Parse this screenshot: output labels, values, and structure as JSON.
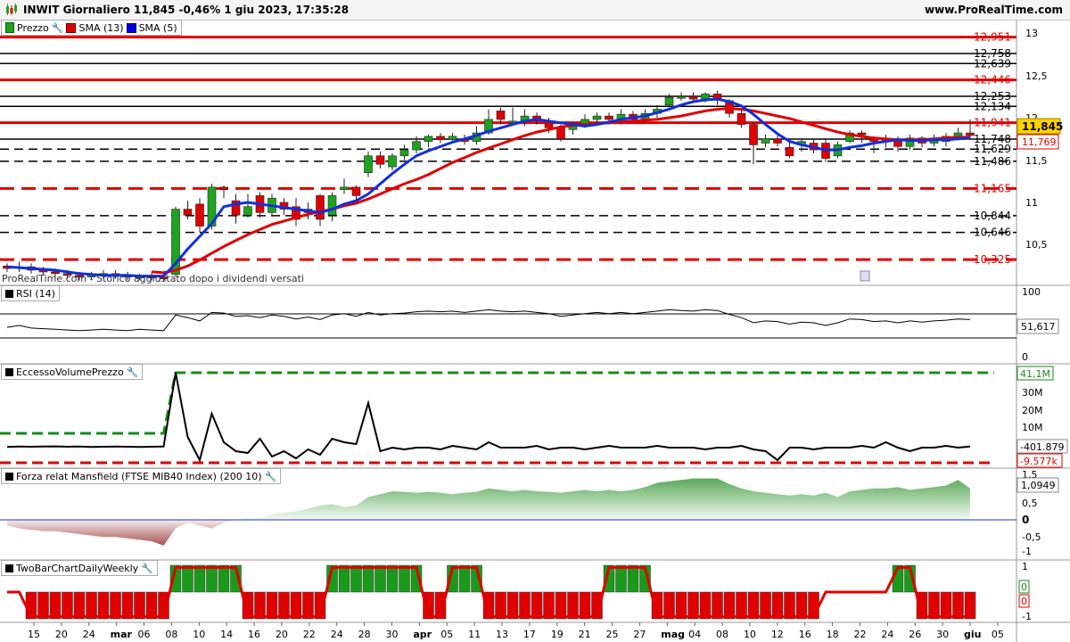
{
  "header": {
    "title": "INWIT Giornaliero 11,845 -0,46% 1 giu 2023, 17:35:28",
    "site": "www.ProRealTime.com"
  },
  "panels": {
    "price": {
      "legend": [
        {
          "label": "Prezzo",
          "color": "#1ea31e",
          "icon": "candlestick-icon"
        },
        {
          "label": "SMA (13)",
          "color": "#e00000",
          "icon": "square-icon"
        },
        {
          "label": "SMA (5)",
          "color": "#0000e0",
          "icon": "square-icon"
        }
      ],
      "watermark": "ProRealTime.com - Storico aggiustato dopo i dividendi versati",
      "y_ticks": [
        "13",
        "12,5",
        "12",
        "11,5",
        "11",
        "10,5"
      ],
      "current_price": "11,845",
      "sma13_value": "11,769"
    },
    "rsi": {
      "label": "RSI (14)",
      "y_ticks": [
        "100",
        "0"
      ],
      "value": "51,617"
    },
    "eccesso": {
      "label": "EccessoVolumePrezzo",
      "y_ticks": [
        "30M",
        "20M",
        "10M"
      ],
      "upper_value": "41,1M",
      "value": "-401.879",
      "lower_value": "-9.577k"
    },
    "mansfield": {
      "label": "Forza relat Mansfield (FTSE MIB40 Index) (200 10)",
      "y_ticks": [
        "1,5",
        "0,5",
        "0",
        "-0,5",
        "-1"
      ],
      "value": "1,0949"
    },
    "twobar": {
      "label": "TwoBarChartDailyWeekly",
      "y_ticks": [
        "1",
        "-1"
      ],
      "value1": "0",
      "value2": "0"
    }
  },
  "price_levels": [
    {
      "value": "12,951",
      "color": "#e00000",
      "style": "solid"
    },
    {
      "value": "12,758",
      "color": "#000000",
      "style": "solid"
    },
    {
      "value": "12,639",
      "color": "#000000",
      "style": "solid"
    },
    {
      "value": "12,446",
      "color": "#e00000",
      "style": "solid"
    },
    {
      "value": "12,253",
      "color": "#000000",
      "style": "solid"
    },
    {
      "value": "12,134",
      "color": "#000000",
      "style": "solid"
    },
    {
      "value": "11,941",
      "color": "#e00000",
      "style": "solid"
    },
    {
      "value": "11,748",
      "color": "#000000",
      "style": "solid"
    },
    {
      "value": "11,629",
      "color": "#000000",
      "style": "dashed"
    },
    {
      "value": "11,486",
      "color": "#000000",
      "style": "dashed"
    },
    {
      "value": "11,165",
      "color": "#e00000",
      "style": "dashed"
    },
    {
      "value": "10,844",
      "color": "#000000",
      "style": "dashed"
    },
    {
      "value": "10,646",
      "color": "#000000",
      "style": "dashed"
    },
    {
      "value": "10,325",
      "color": "#e00000",
      "style": "dashed"
    }
  ],
  "x_labels": [
    "15",
    "20",
    "24",
    "mar",
    "06",
    "08",
    "10",
    "14",
    "16",
    "20",
    "22",
    "24",
    "28",
    "30",
    "apr",
    "05",
    "11",
    "13",
    "17",
    "19",
    "21",
    "25",
    "27",
    "mag",
    "04",
    "08",
    "10",
    "12",
    "16",
    "18",
    "22",
    "24",
    "26",
    "30",
    "giu",
    "05"
  ],
  "chart_data": {
    "type": "candlestick",
    "ylim": [
      10.1,
      13.1
    ],
    "candles": [
      [
        10.25,
        10.22,
        10.28,
        10.18
      ],
      [
        10.22,
        10.24,
        10.3,
        10.18
      ],
      [
        10.24,
        10.2,
        10.28,
        10.16
      ],
      [
        10.2,
        10.18,
        10.24,
        10.14
      ],
      [
        10.18,
        10.16,
        10.22,
        10.12
      ],
      [
        10.16,
        10.14,
        10.2,
        10.1
      ],
      [
        10.14,
        10.12,
        10.18,
        10.08
      ],
      [
        10.12,
        10.14,
        10.18,
        10.08
      ],
      [
        10.14,
        10.16,
        10.2,
        10.1
      ],
      [
        10.16,
        10.14,
        10.2,
        10.1
      ],
      [
        10.14,
        10.12,
        10.18,
        10.08
      ],
      [
        10.12,
        10.13,
        10.16,
        10.08
      ],
      [
        10.13,
        10.12,
        10.17,
        10.08
      ],
      [
        10.12,
        10.11,
        10.16,
        10.07
      ],
      [
        10.15,
        10.92,
        10.95,
        10.12
      ],
      [
        10.92,
        10.85,
        11.02,
        10.8
      ],
      [
        10.98,
        10.72,
        11.05,
        10.65
      ],
      [
        10.72,
        11.18,
        11.22,
        10.68
      ],
      [
        11.18,
        11.15,
        11.2,
        11.05
      ],
      [
        11.02,
        10.85,
        11.1,
        10.75
      ],
      [
        10.85,
        10.95,
        11.1,
        10.82
      ],
      [
        11.08,
        10.88,
        11.12,
        10.82
      ],
      [
        10.88,
        11.05,
        11.1,
        10.85
      ],
      [
        11.0,
        10.92,
        11.05,
        10.85
      ],
      [
        10.95,
        10.8,
        11.05,
        10.72
      ],
      [
        10.92,
        10.88,
        11.0,
        10.8
      ],
      [
        11.08,
        10.8,
        11.1,
        10.72
      ],
      [
        10.85,
        11.08,
        11.12,
        10.78
      ],
      [
        11.15,
        11.18,
        11.28,
        11.1
      ],
      [
        11.18,
        11.08,
        11.2,
        11.0
      ],
      [
        11.35,
        11.55,
        11.6,
        11.3
      ],
      [
        11.55,
        11.45,
        11.6,
        11.4
      ],
      [
        11.42,
        11.55,
        11.58,
        11.38
      ],
      [
        11.55,
        11.62,
        11.68,
        11.5
      ],
      [
        11.62,
        11.72,
        11.78,
        11.58
      ],
      [
        11.72,
        11.78,
        11.8,
        11.65
      ],
      [
        11.78,
        11.74,
        11.82,
        11.7
      ],
      [
        11.74,
        11.78,
        11.82,
        11.7
      ],
      [
        11.75,
        11.72,
        11.8,
        11.68
      ],
      [
        11.72,
        11.82,
        11.9,
        11.68
      ],
      [
        11.82,
        11.98,
        12.1,
        11.8
      ],
      [
        12.08,
        11.98,
        12.12,
        11.92
      ],
      [
        11.95,
        11.96,
        12.12,
        11.92
      ],
      [
        11.96,
        12.02,
        12.1,
        11.9
      ],
      [
        12.02,
        11.96,
        12.06,
        11.92
      ],
      [
        11.96,
        11.88,
        12.0,
        11.82
      ],
      [
        11.88,
        11.75,
        11.92,
        11.72
      ],
      [
        11.86,
        11.92,
        11.95,
        11.8
      ],
      [
        11.92,
        11.98,
        12.04,
        11.88
      ],
      [
        11.98,
        12.02,
        12.06,
        11.92
      ],
      [
        12.02,
        11.98,
        12.06,
        11.92
      ],
      [
        11.98,
        12.04,
        12.1,
        11.92
      ],
      [
        12.04,
        11.98,
        12.08,
        11.95
      ],
      [
        11.98,
        12.05,
        12.1,
        11.95
      ],
      [
        12.05,
        12.1,
        12.15,
        12.0
      ],
      [
        12.15,
        12.24,
        12.28,
        12.12
      ],
      [
        12.24,
        12.25,
        12.3,
        12.2
      ],
      [
        12.25,
        12.22,
        12.3,
        12.18
      ],
      [
        12.22,
        12.28,
        12.3,
        12.18
      ],
      [
        12.28,
        12.22,
        12.32,
        12.15
      ],
      [
        12.2,
        12.05,
        12.22,
        12.0
      ],
      [
        12.05,
        11.92,
        12.1,
        11.88
      ],
      [
        11.92,
        11.68,
        11.95,
        11.45
      ],
      [
        11.7,
        11.75,
        11.8,
        11.65
      ],
      [
        11.75,
        11.7,
        11.8,
        11.66
      ],
      [
        11.65,
        11.55,
        11.72,
        11.52
      ],
      [
        11.68,
        11.72,
        11.76,
        11.6
      ],
      [
        11.7,
        11.62,
        11.75,
        11.58
      ],
      [
        11.7,
        11.52,
        11.76,
        11.48
      ],
      [
        11.55,
        11.68,
        11.72,
        11.52
      ],
      [
        11.72,
        11.82,
        11.85,
        11.7
      ],
      [
        11.82,
        11.8,
        11.85,
        11.7
      ],
      [
        11.75,
        11.72,
        11.78,
        11.58
      ],
      [
        11.72,
        11.74,
        11.8,
        11.65
      ],
      [
        11.74,
        11.66,
        11.78,
        11.6
      ],
      [
        11.66,
        11.76,
        11.8,
        11.62
      ],
      [
        11.76,
        11.7,
        11.78,
        11.65
      ],
      [
        11.7,
        11.76,
        11.8,
        11.66
      ],
      [
        11.72,
        11.78,
        11.82,
        11.66
      ],
      [
        11.78,
        11.82,
        11.88,
        11.74
      ],
      [
        11.82,
        11.79,
        11.98,
        11.76
      ]
    ],
    "sma5": [
      10.24,
      10.23,
      10.22,
      10.21,
      10.2,
      10.18,
      10.16,
      10.15,
      10.14,
      10.14,
      10.14,
      10.13,
      10.13,
      10.13,
      10.28,
      10.45,
      10.6,
      10.75,
      10.95,
      10.98,
      11.0,
      10.98,
      10.96,
      10.94,
      10.92,
      10.9,
      10.88,
      10.92,
      10.98,
      11.02,
      11.1,
      11.22,
      11.34,
      11.45,
      11.55,
      11.61,
      11.66,
      11.71,
      11.75,
      11.79,
      11.84,
      11.88,
      11.92,
      11.96,
      11.98,
      11.96,
      11.94,
      11.92,
      11.9,
      11.92,
      11.95,
      11.98,
      12.0,
      12.02,
      12.06,
      12.1,
      12.15,
      12.19,
      12.21,
      12.22,
      12.19,
      12.14,
      12.04,
      11.92,
      11.81,
      11.72,
      11.68,
      11.65,
      11.62,
      11.62,
      11.65,
      11.67,
      11.7,
      11.72,
      11.74,
      11.73,
      11.73,
      11.74,
      11.74,
      11.75,
      11.76
    ],
    "sma13": [
      null,
      null,
      null,
      null,
      null,
      null,
      null,
      null,
      null,
      null,
      null,
      null,
      10.18,
      10.17,
      10.2,
      10.25,
      10.32,
      10.4,
      10.48,
      10.55,
      10.62,
      10.68,
      10.74,
      10.78,
      10.82,
      10.86,
      10.89,
      10.92,
      10.96,
      10.99,
      11.04,
      11.1,
      11.16,
      11.22,
      11.27,
      11.33,
      11.4,
      11.47,
      11.53,
      11.59,
      11.64,
      11.69,
      11.74,
      11.79,
      11.83,
      11.86,
      11.89,
      11.91,
      11.92,
      11.93,
      11.94,
      11.95,
      11.96,
      11.97,
      11.98,
      12.0,
      12.02,
      12.05,
      12.08,
      12.1,
      12.11,
      12.1,
      12.08,
      12.05,
      12.02,
      11.99,
      11.95,
      11.91,
      11.87,
      11.83,
      11.8,
      11.78,
      11.76,
      11.75,
      11.74,
      11.74,
      11.74,
      11.75,
      11.76,
      11.77,
      11.77
    ],
    "rsi": [
      45,
      48,
      44,
      43,
      42,
      41,
      40,
      41,
      42,
      41,
      40,
      42,
      41,
      40,
      64,
      60,
      55,
      68,
      67,
      62,
      63,
      60,
      64,
      62,
      58,
      61,
      57,
      64,
      66,
      62,
      68,
      64,
      66,
      67,
      69,
      70,
      69,
      70,
      68,
      70,
      72,
      70,
      69,
      70,
      68,
      66,
      62,
      64,
      66,
      68,
      66,
      68,
      66,
      68,
      70,
      72,
      71,
      70,
      72,
      71,
      65,
      60,
      52,
      55,
      54,
      50,
      53,
      52,
      48,
      52,
      58,
      57,
      54,
      55,
      52,
      55,
      53,
      55,
      56,
      58,
      57
    ],
    "eccesso": [
      -0.6,
      -0.4,
      -0.5,
      -0.4,
      -0.3,
      -0.5,
      -0.4,
      -0.6,
      -0.5,
      -0.4,
      -0.5,
      -0.6,
      -0.5,
      -0.4,
      41,
      5,
      -8,
      18,
      2,
      -3,
      -4,
      4,
      -6,
      -3,
      -7,
      -2,
      -5,
      4,
      2,
      1,
      24,
      -3,
      -1,
      -2,
      -1,
      -1,
      -2,
      0,
      -1,
      -2,
      2,
      -1,
      -1,
      -1,
      0,
      -2,
      -1,
      -1,
      -2,
      -1,
      0,
      -1,
      -1,
      -1,
      0,
      -1,
      -1,
      -1,
      -2,
      -1,
      -1,
      0,
      -2,
      -3,
      -8,
      -1,
      -1,
      -2,
      -1,
      -1,
      -1,
      0,
      -1,
      2,
      -1,
      -3,
      -1,
      -1,
      0,
      -1,
      -0.4
    ],
    "mansfield": [
      -0.2,
      -0.3,
      -0.35,
      -0.4,
      -0.4,
      -0.45,
      -0.5,
      -0.55,
      -0.6,
      -0.6,
      -0.65,
      -0.7,
      -0.75,
      -0.9,
      -0.3,
      -0.1,
      -0.2,
      -0.3,
      -0.1,
      0,
      0.05,
      0.05,
      0.2,
      0.25,
      0.3,
      0.4,
      0.5,
      0.55,
      0.45,
      0.5,
      0.8,
      0.9,
      1.0,
      0.98,
      0.95,
      0.98,
      0.95,
      0.9,
      0.95,
      0.98,
      1.1,
      1.05,
      1.0,
      1.05,
      1.0,
      0.98,
      0.95,
      1.0,
      1.05,
      1.0,
      1.05,
      1.0,
      1.05,
      1.15,
      1.3,
      1.35,
      1.4,
      1.45,
      1.45,
      1.45,
      1.25,
      1.1,
      1.0,
      0.95,
      0.9,
      0.85,
      0.9,
      0.85,
      0.95,
      0.8,
      1.0,
      1.05,
      1.1,
      1.1,
      1.15,
      1.05,
      1.1,
      1.15,
      1.2,
      1.4,
      1.1
    ],
    "twobar": [
      0,
      0,
      -1,
      -1,
      -1,
      -1,
      -1,
      -1,
      -1,
      -1,
      -1,
      -1,
      -1,
      -1,
      1,
      1,
      1,
      1,
      1,
      1,
      -1,
      -1,
      -1,
      -1,
      -1,
      -1,
      -1,
      1,
      1,
      1,
      1,
      1,
      1,
      1,
      1,
      -1,
      -1,
      1,
      1,
      1,
      -1,
      -1,
      -1,
      -1,
      -1,
      -1,
      -1,
      -1,
      -1,
      -1,
      1,
      1,
      1,
      1,
      -1,
      -1,
      -1,
      -1,
      -1,
      -1,
      -1,
      -1,
      -1,
      -1,
      -1,
      -1,
      -1,
      -1,
      0,
      0,
      0,
      0,
      0,
      0,
      1,
      1,
      -1,
      -1,
      -1,
      -1,
      -1
    ]
  }
}
